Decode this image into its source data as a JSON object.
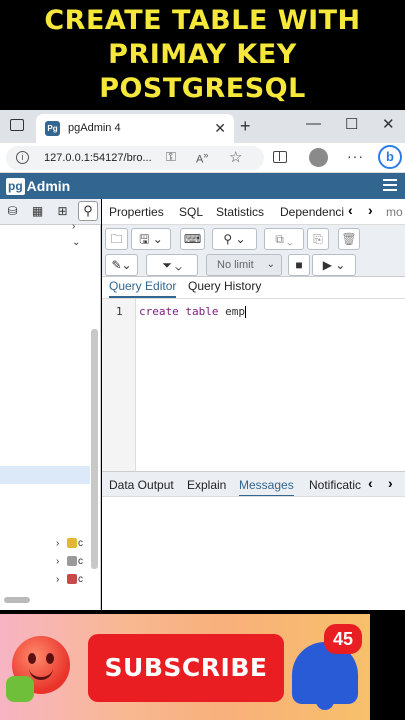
{
  "banner": {
    "line1": "CREATE TABLE WITH",
    "line2": "PRIMAY KEY",
    "line3": "POSTGRESQL"
  },
  "browser": {
    "tab_title": "pgAdmin 4",
    "favicon": "Pg",
    "url": "127.0.0.1:54127/bro...",
    "bing_label": "b"
  },
  "app": {
    "logo_pg": "pg",
    "logo_text": "Admin"
  },
  "tree": {
    "rows": [
      {
        "label": "c"
      },
      {
        "label": "c"
      },
      {
        "label": "c"
      }
    ]
  },
  "panel_tabs": [
    "Properties",
    "SQL",
    "Statistics",
    "Dependenci",
    "mo"
  ],
  "toolbar": {
    "limit_label": "No limit"
  },
  "query_tabs": {
    "editor": "Query Editor",
    "history": "Query History"
  },
  "editor": {
    "line_number": "1",
    "kw1": "create",
    "kw2": "table",
    "ident": "emp"
  },
  "output_tabs": [
    "Data Output",
    "Explain",
    "Messages",
    "Notificatic"
  ],
  "promo": {
    "subscribe_label": "SUBSCRIBE",
    "notification_count": "45"
  },
  "colors": {
    "banner_text": "#f5e83a",
    "pgadmin_header": "#326690",
    "subscribe_red": "#e91e22",
    "bell_blue": "#2a5bd7"
  }
}
